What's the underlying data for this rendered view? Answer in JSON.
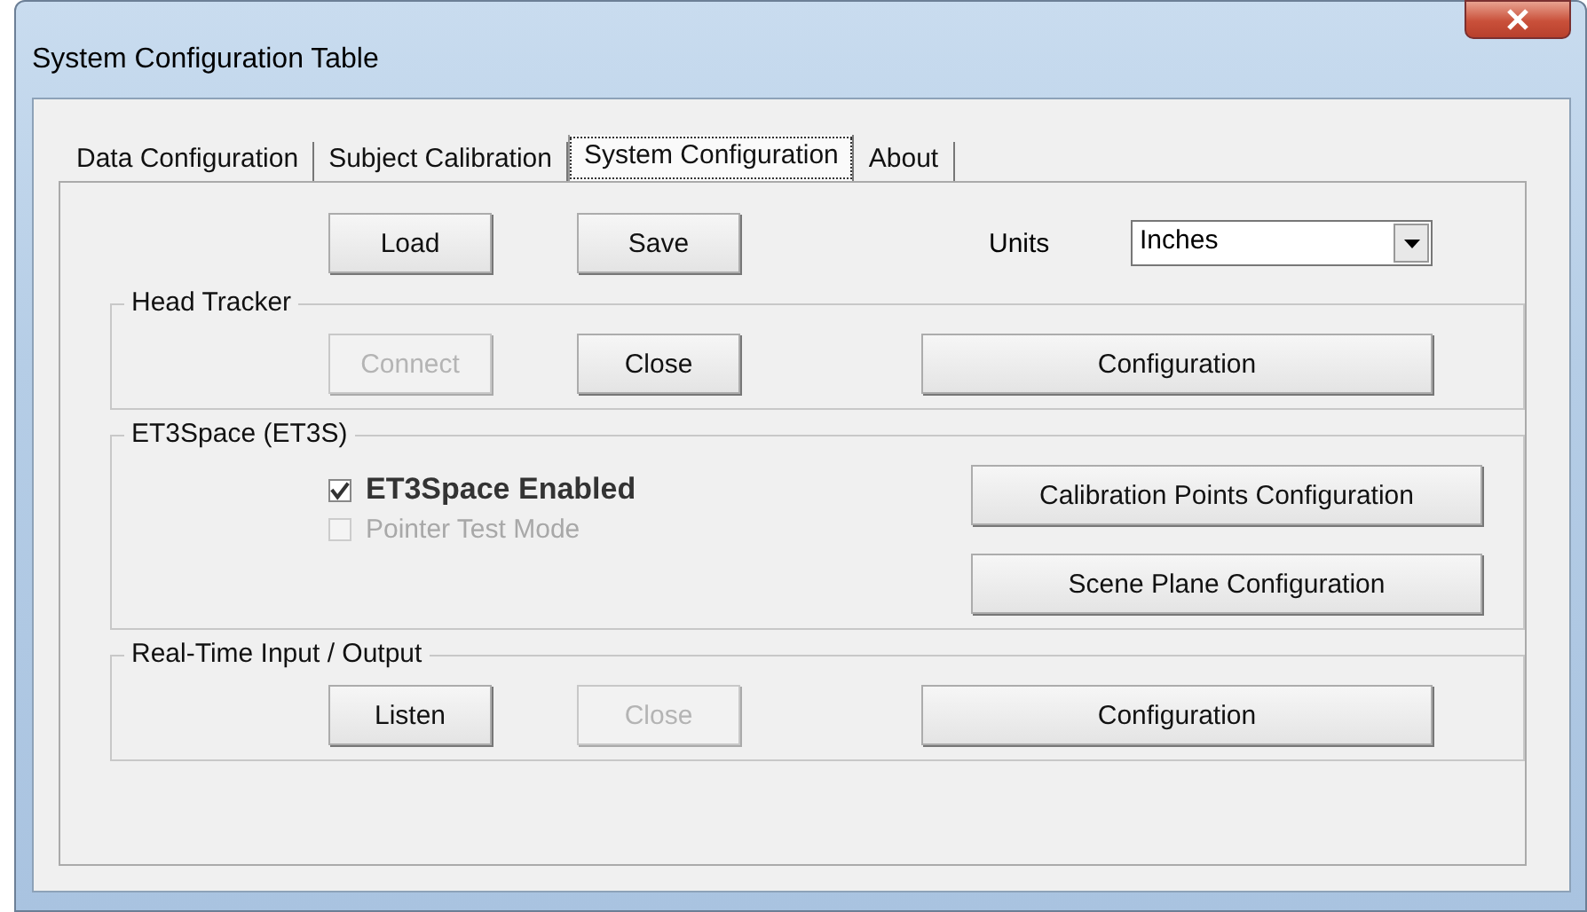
{
  "window": {
    "title": "System Configuration Table"
  },
  "tabs": [
    {
      "label": "Data Configuration",
      "selected": false
    },
    {
      "label": "Subject Calibration",
      "selected": false
    },
    {
      "label": "System Configuration",
      "selected": true
    },
    {
      "label": "About",
      "selected": false
    }
  ],
  "top_buttons": [
    {
      "label": "Load",
      "disabled": false
    },
    {
      "label": "Save",
      "disabled": false
    }
  ],
  "units": {
    "label": "Units",
    "value": "Inches"
  },
  "groups": [
    {
      "title": "Head Tracker",
      "kind": "buttons",
      "buttons": [
        {
          "label": "Connect",
          "disabled": true
        },
        {
          "label": "Close",
          "disabled": false
        },
        {
          "label": "Configuration",
          "disabled": false
        }
      ]
    },
    {
      "title": "ET3Space (ET3S)",
      "kind": "options",
      "checkboxes": [
        {
          "label": "ET3Space Enabled",
          "checked": true,
          "disabled": false,
          "emphasis": true
        },
        {
          "label": "Pointer Test Mode",
          "checked": false,
          "disabled": true,
          "emphasis": false
        }
      ],
      "buttons": [
        {
          "label": "Calibration Points Configuration",
          "disabled": false
        },
        {
          "label": "Scene Plane Configuration",
          "disabled": false
        }
      ]
    },
    {
      "title": "Real-Time Input / Output",
      "kind": "buttons",
      "buttons": [
        {
          "label": "Listen",
          "disabled": false
        },
        {
          "label": "Close",
          "disabled": true
        },
        {
          "label": "Configuration",
          "disabled": false
        }
      ]
    }
  ]
}
